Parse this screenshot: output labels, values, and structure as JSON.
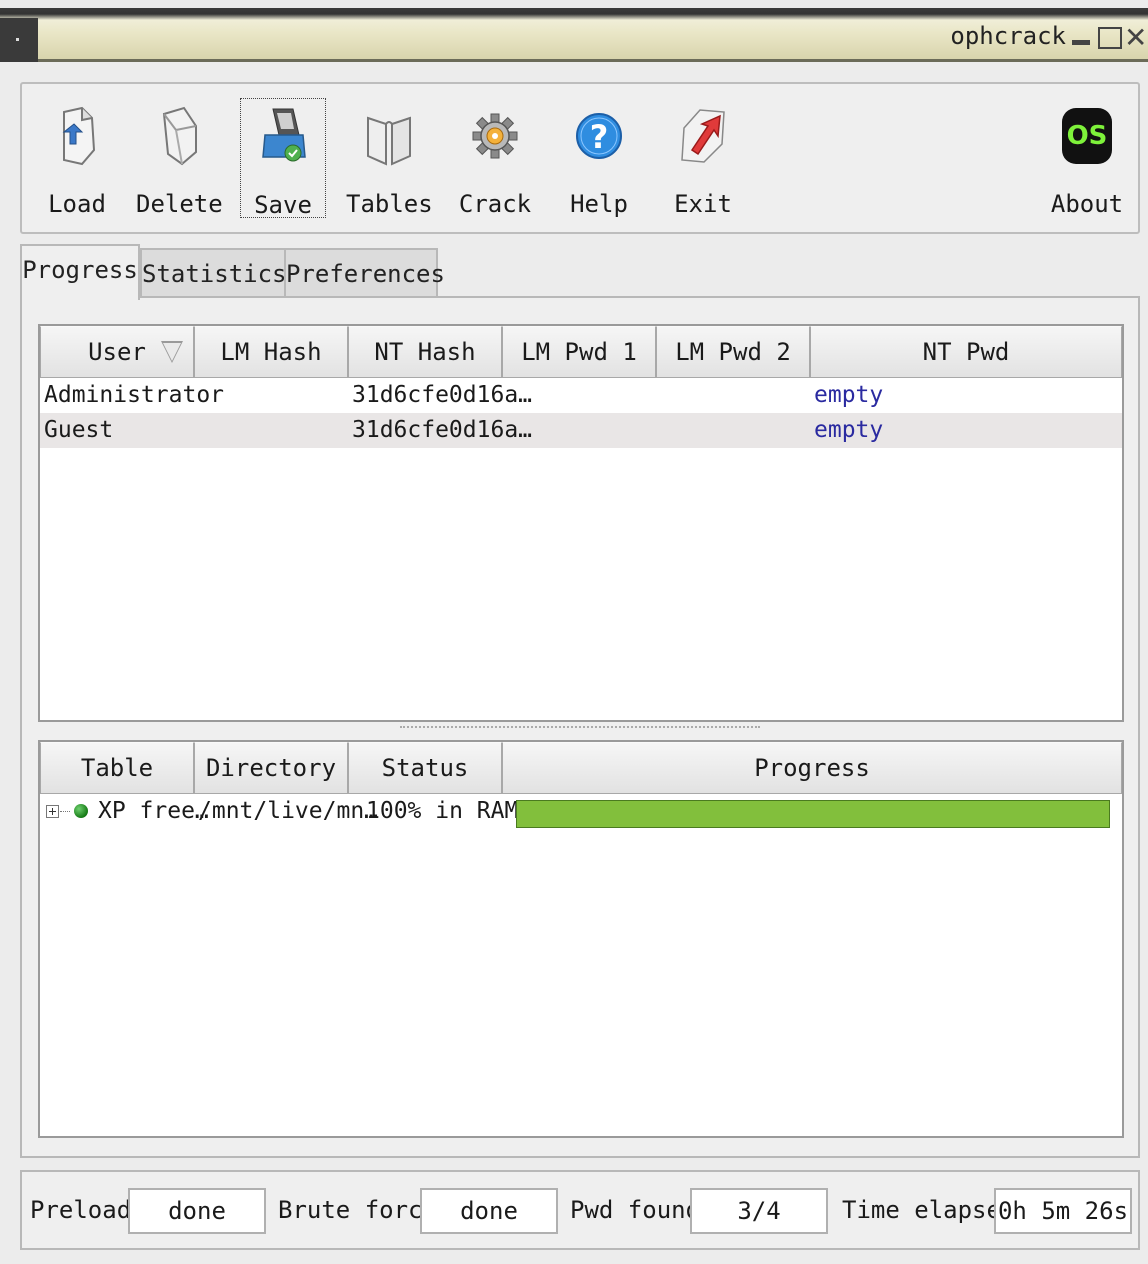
{
  "window": {
    "title": "ophcrack"
  },
  "toolbar": {
    "load": "Load",
    "delete": "Delete",
    "save": "Save",
    "tables": "Tables",
    "crack": "Crack",
    "help": "Help",
    "exit": "Exit",
    "about": "About",
    "about_badge": "OS"
  },
  "tabs": [
    "Progress",
    "Statistics",
    "Preferences"
  ],
  "users_table": {
    "columns": [
      "User",
      "LM Hash",
      "NT Hash",
      "LM Pwd 1",
      "LM Pwd 2",
      "NT Pwd"
    ],
    "rows": [
      {
        "user": "Administrator",
        "lm_hash": "",
        "nt_hash": "31d6cfe0d16a…",
        "lm_pwd1": "",
        "lm_pwd2": "",
        "nt_pwd": "empty"
      },
      {
        "user": "Guest",
        "lm_hash": "",
        "nt_hash": "31d6cfe0d16a…",
        "lm_pwd1": "",
        "lm_pwd2": "",
        "nt_pwd": "empty"
      }
    ]
  },
  "tables_table": {
    "columns": [
      "Table",
      "Directory",
      "Status",
      "Progress"
    ],
    "rows": [
      {
        "table": "XP free…",
        "directory": "/mnt/live/mn…",
        "status": "100% in RAM",
        "progress": 100
      }
    ]
  },
  "status": {
    "preload_label": "Preload:",
    "preload_value": "done",
    "brute_label": "Brute force:",
    "brute_value": "done",
    "pwd_label": "Pwd found:",
    "pwd_value": "3/4",
    "time_label": "Time elapsed:",
    "time_value": "0h 5m 26s"
  },
  "colors": {
    "progress_fill": "#82bf3c",
    "link_blue": "#2a2aa0"
  }
}
